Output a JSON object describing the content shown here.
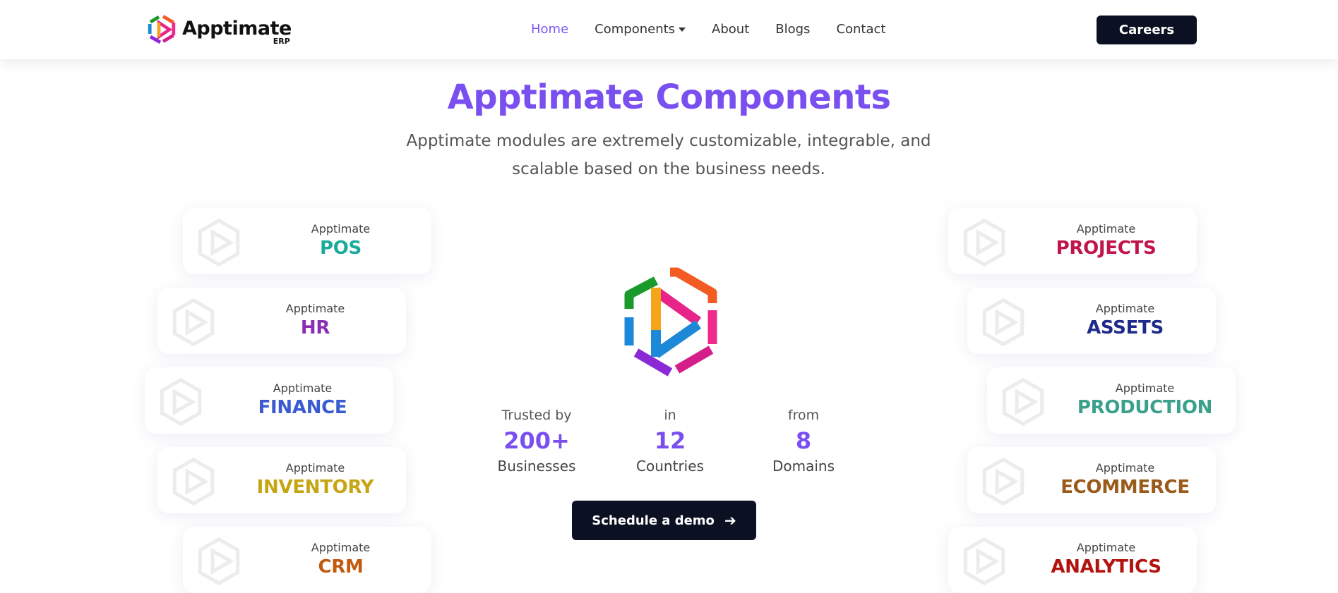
{
  "brand": {
    "name": "Apptimate",
    "sub": "ERP"
  },
  "nav": {
    "items": [
      {
        "label": "Home",
        "active": true
      },
      {
        "label": "Components",
        "dropdown": true
      },
      {
        "label": "About"
      },
      {
        "label": "Blogs"
      },
      {
        "label": "Contact"
      }
    ],
    "careers_label": "Careers"
  },
  "hero": {
    "title": "Apptimate Components",
    "subtitle": "Apptimate modules are extremely customizable, integrable, and scalable based on the business needs."
  },
  "modules_left": [
    {
      "prefix": "Apptimate",
      "name": "POS",
      "color": "#1aab9b"
    },
    {
      "prefix": "Apptimate",
      "name": "HR",
      "color": "#8a2db5"
    },
    {
      "prefix": "Apptimate",
      "name": "FINANCE",
      "color": "#3a5bd0"
    },
    {
      "prefix": "Apptimate",
      "name": "INVENTORY",
      "color": "#c6a514"
    },
    {
      "prefix": "Apptimate",
      "name": "CRM",
      "color": "#c25a10"
    }
  ],
  "modules_right": [
    {
      "prefix": "Apptimate",
      "name": "PROJECTS",
      "color": "#c0144a"
    },
    {
      "prefix": "Apptimate",
      "name": "ASSETS",
      "color": "#1e2a8a"
    },
    {
      "prefix": "Apptimate",
      "name": "PRODUCTION",
      "color": "#3aa08c"
    },
    {
      "prefix": "Apptimate",
      "name": "ECOMMERCE",
      "color": "#9a5a1a"
    },
    {
      "prefix": "Apptimate",
      "name": "ANALYTICS",
      "color": "#b3130f"
    }
  ],
  "stats": [
    {
      "pre": "Trusted by",
      "num": "200+",
      "post": "Businesses"
    },
    {
      "pre": "in",
      "num": "12",
      "post": "Countries"
    },
    {
      "pre": "from",
      "num": "8",
      "post": "Domains"
    }
  ],
  "cta": {
    "label": "Schedule a demo"
  },
  "colors": {
    "accent": "#7a4ff0",
    "dark": "#0b1022"
  }
}
